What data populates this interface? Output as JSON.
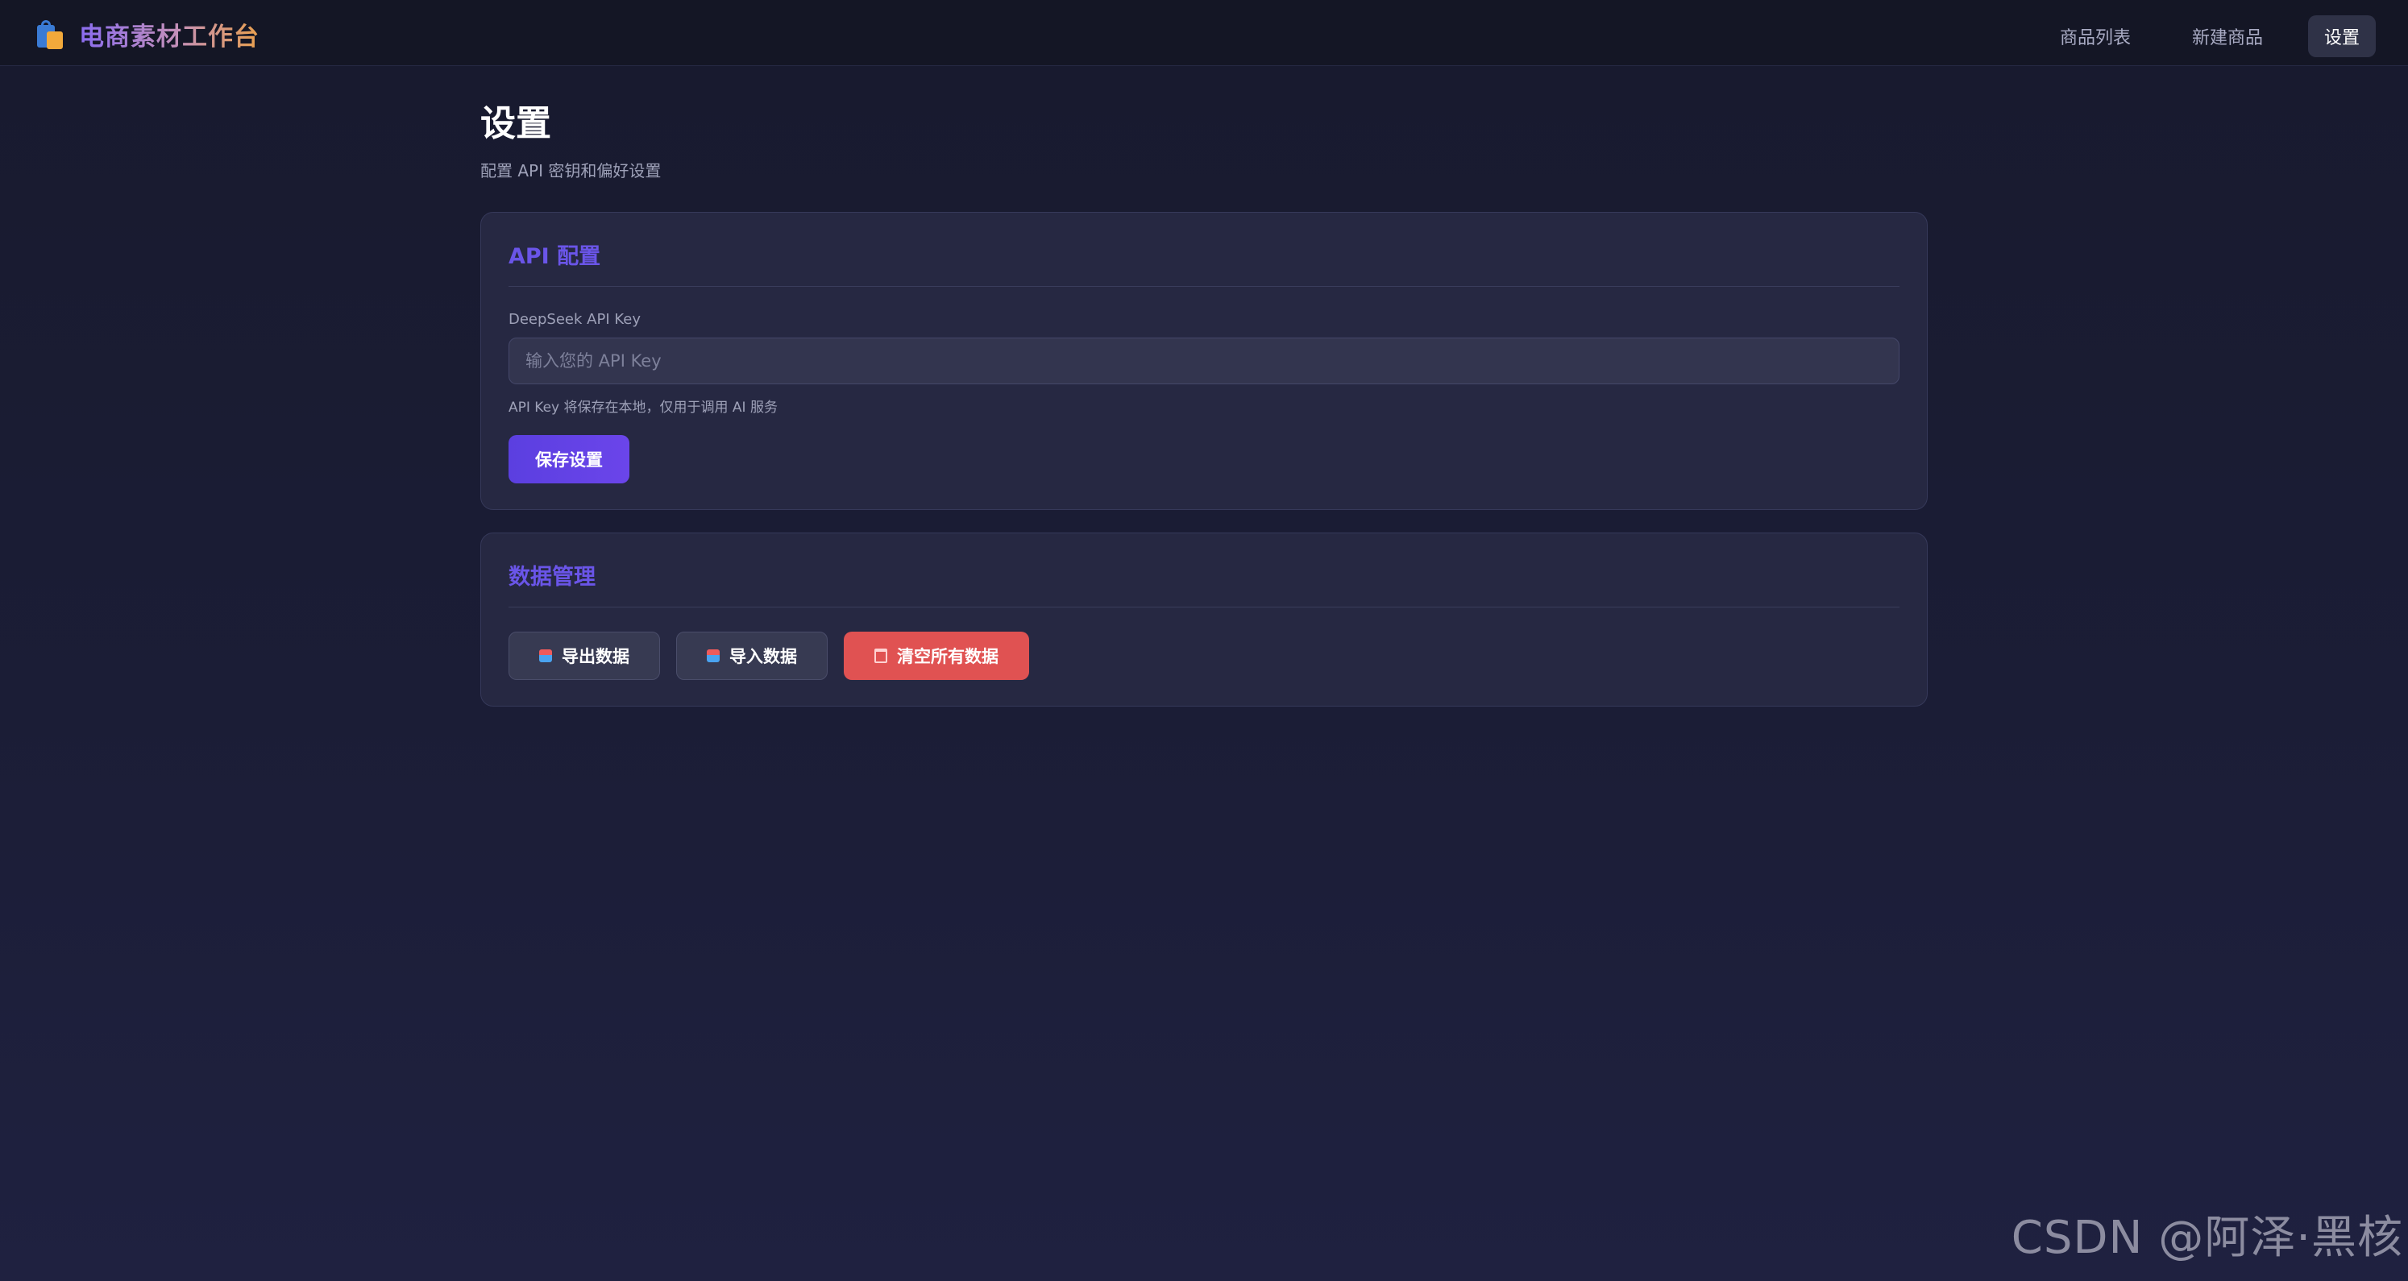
{
  "app": {
    "title": "电商素材工作台",
    "brand_icon": "shopping-bags-icon"
  },
  "nav": {
    "items": [
      {
        "label": "商品列表",
        "active": false
      },
      {
        "label": "新建商品",
        "active": false
      },
      {
        "label": "设置",
        "active": true
      }
    ]
  },
  "page": {
    "title": "设置",
    "subtitle": "配置 API 密钥和偏好设置"
  },
  "api_card": {
    "title": "API 配置",
    "field_label": "DeepSeek API Key",
    "input_value": "",
    "input_placeholder": "输入您的 API Key",
    "hint": "API Key 将保存在本地，仅用于调用 AI 服务",
    "save_label": "保存设置"
  },
  "data_card": {
    "title": "数据管理",
    "export_label": "导出数据",
    "export_icon": "package-icon",
    "import_label": "导入数据",
    "import_icon": "package-icon",
    "clear_label": "清空所有数据",
    "clear_icon": "trash-icon"
  },
  "colors": {
    "accent": "#6a55e8",
    "primary_button": "#5b3fe0",
    "danger_button": "#e05252",
    "background": "#1b1d36"
  },
  "watermark": "CSDN @阿泽·黑核"
}
